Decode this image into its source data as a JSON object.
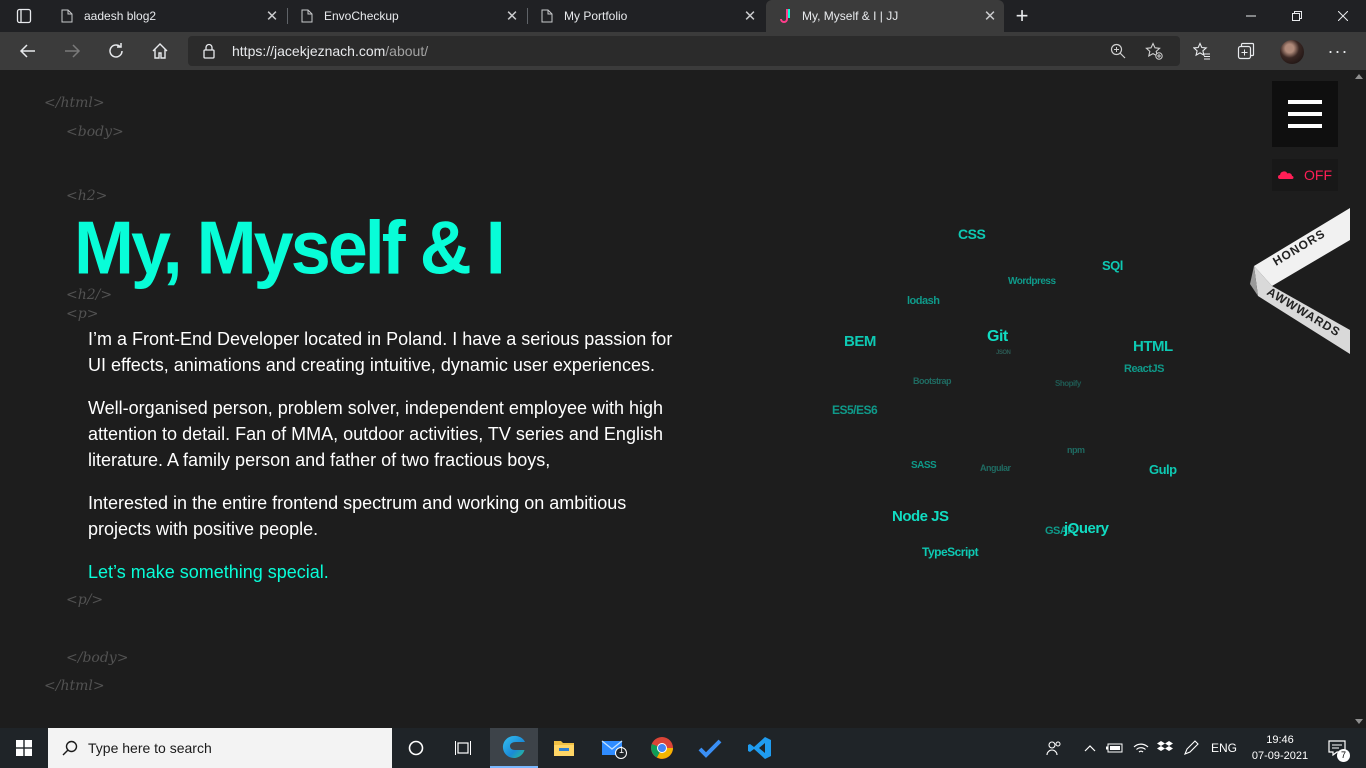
{
  "browser": {
    "tabs": [
      {
        "title": "aadesh blog2",
        "icon": "page-icon"
      },
      {
        "title": "EnvoCheckup",
        "icon": "page-icon"
      },
      {
        "title": "My Portfolio",
        "icon": "page-icon"
      },
      {
        "title": "My, Myself & I | JJ",
        "icon": "jj-logo-icon",
        "active": true
      }
    ],
    "address": {
      "domain": "https://jacekjeznach.com",
      "path": "/about/"
    }
  },
  "page": {
    "tags": {
      "html_open": "</html>",
      "body_open": "<body>",
      "h2_open": "<h2>",
      "h2_close": "<h2/>",
      "p_open": "<p>",
      "p_close": "<p/>",
      "body_close": "</body>",
      "html_close": "</html>"
    },
    "title": "My, Myself & I",
    "paragraphs": [
      "I’m a Front-End Developer located in Poland. I have a serious passion for UI effects, animations and creating intuitive, dynamic user experiences.",
      "Well-organised person, problem solver, independent employee with high attention to detail. Fan of MMA, outdoor activities, TV series and English literature. A family person and father of two fractious boys,",
      "Interested in the entire frontend spectrum and working on ambitious projects with positive people."
    ],
    "cta": "Let’s make something special.",
    "sound_label": "OFF",
    "ribbon": {
      "top": "HONORS",
      "bottom": "AWWWARDS"
    },
    "accent_color": "#08fdd8",
    "sound_color": "#ff1e56",
    "skills": [
      {
        "label": "CSS",
        "size": "large"
      },
      {
        "label": "SQl",
        "size": "large"
      },
      {
        "label": "Wordpress",
        "size": "small"
      },
      {
        "label": "lodash",
        "size": "small"
      },
      {
        "label": "BEM",
        "size": "large"
      },
      {
        "label": "Git",
        "size": "xlarge"
      },
      {
        "label": "JSON",
        "size": "tiny"
      },
      {
        "label": "HTML",
        "size": "large"
      },
      {
        "label": "ReactJS",
        "size": "small"
      },
      {
        "label": "Bootstrap",
        "size": "tiny"
      },
      {
        "label": "Shopify",
        "size": "tiny"
      },
      {
        "label": "ES5/ES6",
        "size": "small"
      },
      {
        "label": "npm",
        "size": "tiny"
      },
      {
        "label": "SASS",
        "size": "small"
      },
      {
        "label": "Angular",
        "size": "tiny"
      },
      {
        "label": "Gulp",
        "size": "large"
      },
      {
        "label": "Node JS",
        "size": "large"
      },
      {
        "label": "GSAP",
        "size": "small"
      },
      {
        "label": "jQuery",
        "size": "large"
      },
      {
        "label": "TypeScript",
        "size": "medium"
      }
    ]
  },
  "taskbar": {
    "search_placeholder": "Type here to search",
    "language": "ENG",
    "time": "19:46",
    "date": "07-09-2021",
    "mail_badge": "1",
    "notification_badge": "7"
  }
}
